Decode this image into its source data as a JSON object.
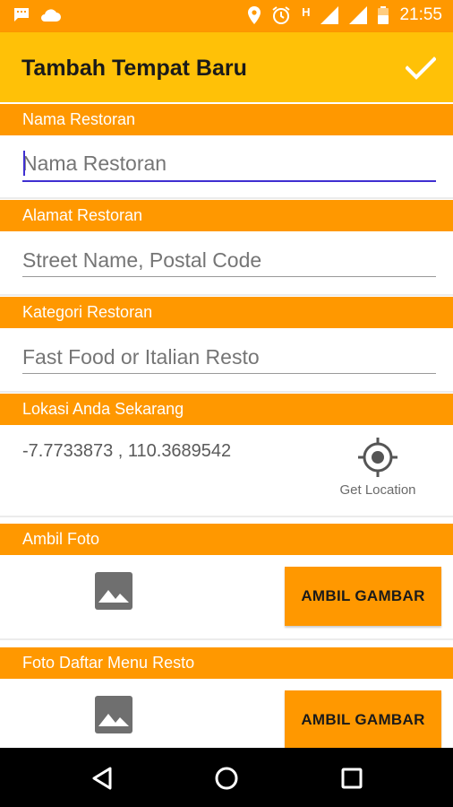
{
  "status_bar": {
    "time": "21:55",
    "network_type": "H",
    "left_icons": [
      "message-icon",
      "cloud-icon"
    ],
    "right_icons": [
      "location-pin-icon",
      "alarm-icon",
      "signal-icon",
      "signal-icon",
      "battery-icon"
    ]
  },
  "app_bar": {
    "title": "Tambah Tempat Baru",
    "confirm_icon": "check-icon"
  },
  "colors": {
    "status_bar": "#ff9800",
    "app_bar": "#ffc107",
    "section_header": "#ff9800",
    "accent_underline": "#3f2fd1",
    "nav_bar": "#000000"
  },
  "form": {
    "nama": {
      "header": "Nama Restoran",
      "placeholder": "Nama Restoran",
      "value": ""
    },
    "alamat": {
      "header": "Alamat Restoran",
      "placeholder": "Street Name, Postal Code",
      "value": ""
    },
    "kategori": {
      "header": "Kategori Restoran",
      "placeholder": "Fast Food or Italian Resto",
      "value": ""
    },
    "lokasi": {
      "header": "Lokasi Anda Sekarang",
      "coordinates": "-7.7733873 , 110.3689542",
      "get_location_label": "Get Location",
      "icon": "gps-target-icon"
    },
    "foto": {
      "header": "Ambil Foto",
      "button_label": "AMBIL GAMBAR",
      "icon": "image-icon"
    },
    "foto_menu": {
      "header": "Foto Daftar Menu Resto",
      "button_label": "AMBIL GAMBAR",
      "icon": "image-icon"
    }
  },
  "nav_bar": {
    "buttons": [
      "back-triangle-icon",
      "home-circle-icon",
      "recents-square-icon"
    ]
  }
}
